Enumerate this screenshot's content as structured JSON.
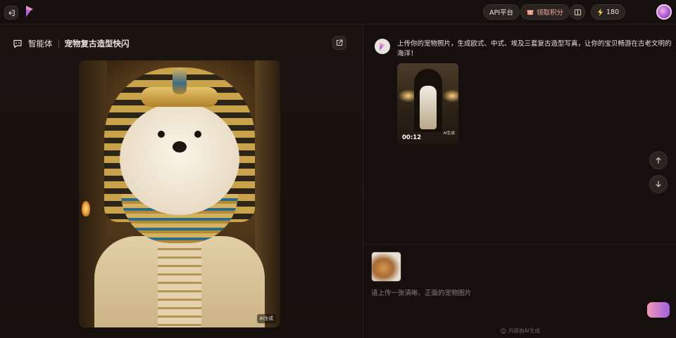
{
  "topbar": {
    "api_label": "API平台",
    "points_label": "领取积分",
    "credits": "180"
  },
  "left": {
    "breadcrumb_root": "智能体",
    "title": "宠物复古造型快闪",
    "image_badge": "AI生成"
  },
  "chat": {
    "bot_message": "上传你的宠物照片，生成欧式、中式、埃及三套复古造型写真，让你的宝贝畅游在古老文明的海洋！",
    "video_time": "00:12",
    "video_badge": "AI生成"
  },
  "input": {
    "placeholder": "请上传一张清晰、正面的宠物图片",
    "footer_note": "内容由AI生成"
  },
  "colors": {
    "accent_pink": "#f49ab7",
    "accent_purple": "#a05fe0",
    "background": "#15100d"
  }
}
